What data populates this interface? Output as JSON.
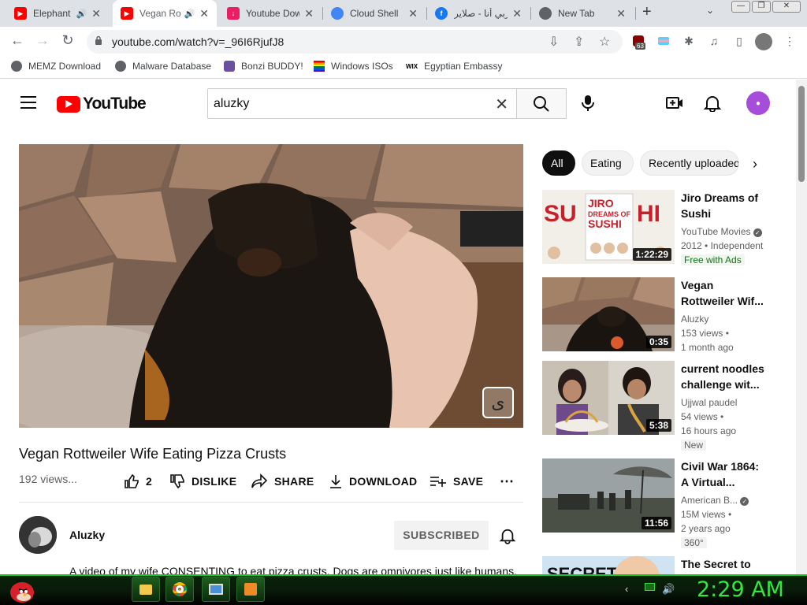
{
  "browser": {
    "tabs": [
      {
        "title": "Elephant",
        "audio": true,
        "icon": "youtube-icon"
      },
      {
        "title": "Vegan Ro",
        "audio": true,
        "icon": "youtube-icon"
      },
      {
        "title": "Youtube Dow",
        "icon": "download-icon"
      },
      {
        "title": "Cloud Shell",
        "icon": "google-cloud-icon"
      },
      {
        "title": "عربي أنا - صلاير",
        "icon": "facebook-icon"
      },
      {
        "title": "New Tab",
        "icon": "chrome-icon"
      }
    ],
    "url": "youtube.com/watch?v=_96I6RjufJ8",
    "extension_badge": "63",
    "bookmarks": [
      "MEMZ Download",
      "Malware Database",
      "Bonzi BUDDY!",
      "Windows ISOs",
      "Egyptian Embassy"
    ],
    "bookmark_wix": "WIX"
  },
  "youtube": {
    "logo_text": "YouTube",
    "search_value": "aluzky",
    "video": {
      "title": "Vegan Rottweiler Wife Eating Pizza Crusts",
      "views": "192 views...",
      "likes": "2",
      "dislike": "DISLIKE",
      "share": "SHARE",
      "download": "DOWNLOAD",
      "save": "SAVE",
      "channel": "Aluzky",
      "subscribe": "SUBSCRIBED",
      "description": "A video of my wife CONSENTING to eat pizza crusts. Dogs are omnivores just like humans."
    },
    "chips": [
      "All",
      "Eating",
      "Recently uploaded"
    ],
    "recommendations": [
      {
        "title": "Jiro Dreams of Sushi",
        "channel": "YouTube Movies",
        "verified": true,
        "meta": "2012 • Independent",
        "badge": "Free with Ads",
        "duration": "1:22:29",
        "thumb_text": "JIRO DREAMS OF SUSHI"
      },
      {
        "title": "Vegan Rottweiler Wif...",
        "channel": "Aluzky",
        "meta": "153 views •",
        "meta2": "1 month ago",
        "duration": "0:35"
      },
      {
        "title": "current noodles challenge wit...",
        "channel": "Ujjwal paudel",
        "meta": "54 views •",
        "meta2": "16 hours ago",
        "badge": "New",
        "duration": "5:38"
      },
      {
        "title": "Civil War 1864: A Virtual...",
        "channel": "American B...",
        "verified": true,
        "meta": "15M views •",
        "meta2": "2 years ago",
        "badge": "360°",
        "duration": "11:56"
      },
      {
        "title": "The Secret to",
        "thumb_text": "SECRET"
      }
    ]
  },
  "taskbar": {
    "clock": "2:29 AM"
  }
}
